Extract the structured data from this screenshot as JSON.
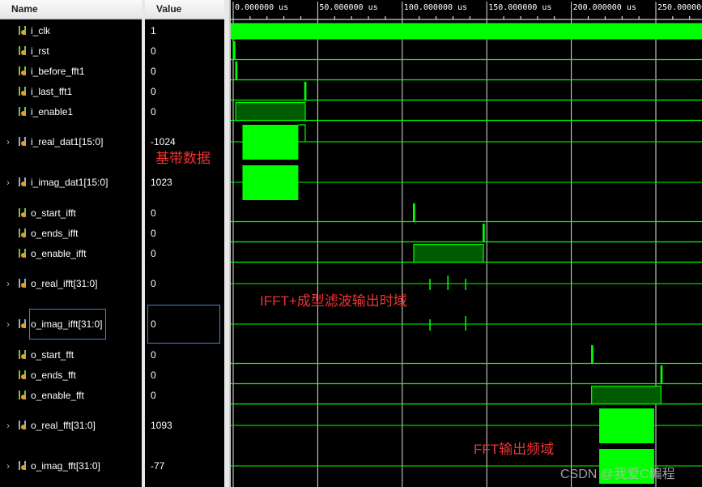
{
  "header": {
    "name": "Name",
    "value": "Value"
  },
  "timeline": {
    "ticks": [
      "0.000000 us",
      "50.000000 us",
      "100.000000 us",
      "150.000000 us",
      "200.000000 us",
      "250.000000"
    ],
    "tick_values_us": [
      0,
      50,
      100,
      150,
      200,
      250
    ]
  },
  "colors": {
    "wave": "#00ff00",
    "wave_dim": "#005a00",
    "grid": "#ffffff",
    "annotation": "#e33333",
    "selection": "#4a7fd6"
  },
  "signals": [
    {
      "name": "i_clk",
      "value": "1",
      "type": "bit",
      "icon": "bit-signal-icon",
      "wave": {
        "clock": true
      }
    },
    {
      "name": "i_rst",
      "value": "0",
      "type": "bit",
      "icon": "bit-signal-icon",
      "wave": {
        "high": [
          [
            0,
            1
          ]
        ]
      }
    },
    {
      "name": "i_before_fft1",
      "value": "0",
      "type": "bit",
      "icon": "bit-signal-icon",
      "wave": {
        "high": [
          [
            1.5,
            2
          ]
        ]
      }
    },
    {
      "name": "i_last_fft1",
      "value": "0",
      "type": "bit",
      "icon": "bit-signal-icon",
      "wave": {
        "high": [
          [
            42.3,
            42.8
          ]
        ]
      }
    },
    {
      "name": "i_enable1",
      "value": "0",
      "type": "bit",
      "icon": "bit-signal-icon",
      "wave": {
        "high": [
          [
            1.5,
            42.6
          ]
        ]
      }
    },
    {
      "name": "i_real_dat1[15:0]",
      "value": "-1024",
      "type": "bus",
      "icon": "bus-signal-icon",
      "wave": {
        "dense": [
          [
            5.5,
            38.5
          ]
        ],
        "step": [
          38.5,
          42.6
        ]
      }
    },
    {
      "name": "i_imag_dat1[15:0]",
      "value": "1023",
      "type": "bus",
      "icon": "bus-signal-icon",
      "wave": {
        "dense": [
          [
            5.5,
            38.5
          ]
        ]
      }
    },
    {
      "name": "o_start_ifft",
      "value": "0",
      "type": "bit",
      "icon": "bit-signal-icon",
      "wave": {
        "high": [
          [
            106.6,
            107.1
          ]
        ]
      }
    },
    {
      "name": "o_ends_ifft",
      "value": "0",
      "type": "bit",
      "icon": "bit-signal-icon",
      "wave": {
        "high": [
          [
            147.8,
            148.3
          ]
        ]
      }
    },
    {
      "name": "o_enable_ifft",
      "value": "0",
      "type": "bit",
      "icon": "bit-signal-icon",
      "wave": {
        "high": [
          [
            106.8,
            148
          ]
        ]
      }
    },
    {
      "name": "o_real_ifft[31:0]",
      "value": "0",
      "type": "bus",
      "icon": "bus-signal-icon",
      "wave": {
        "glitch": [
          116.4,
          127,
          137.5
        ]
      }
    },
    {
      "name": "o_imag_ifft[31:0]",
      "value": "0",
      "type": "bus",
      "icon": "bus-signal-icon",
      "selected": true,
      "wave": {
        "glitch": [
          116.4,
          137.5
        ]
      }
    },
    {
      "name": "o_start_fft",
      "value": "0",
      "type": "bit",
      "icon": "bit-signal-icon",
      "wave": {
        "high": [
          [
            212,
            212.5
          ]
        ]
      }
    },
    {
      "name": "o_ends_fft",
      "value": "0",
      "type": "bit",
      "icon": "bit-signal-icon",
      "wave": {
        "high": [
          [
            253,
            253.5
          ]
        ]
      }
    },
    {
      "name": "o_enable_fft",
      "value": "0",
      "type": "bit",
      "icon": "bit-signal-icon",
      "wave": {
        "high": [
          [
            212,
            253
          ]
        ]
      }
    },
    {
      "name": "o_real_fft[31:0]",
      "value": "1093",
      "type": "bus",
      "icon": "bus-signal-icon",
      "wave": {
        "dense": [
          [
            216.5,
            249
          ]
        ]
      }
    },
    {
      "name": "o_imag_fft[31:0]",
      "value": "-77",
      "type": "bus",
      "icon": "bus-signal-icon",
      "wave": {
        "dense": [
          [
            216.5,
            249
          ]
        ]
      }
    }
  ],
  "annotations": {
    "baseband": "基带数据",
    "ifft": "IFFT+成型滤波输出时域",
    "fft": "FFT输出频域"
  },
  "watermark": "CSDN @我爱C编程"
}
